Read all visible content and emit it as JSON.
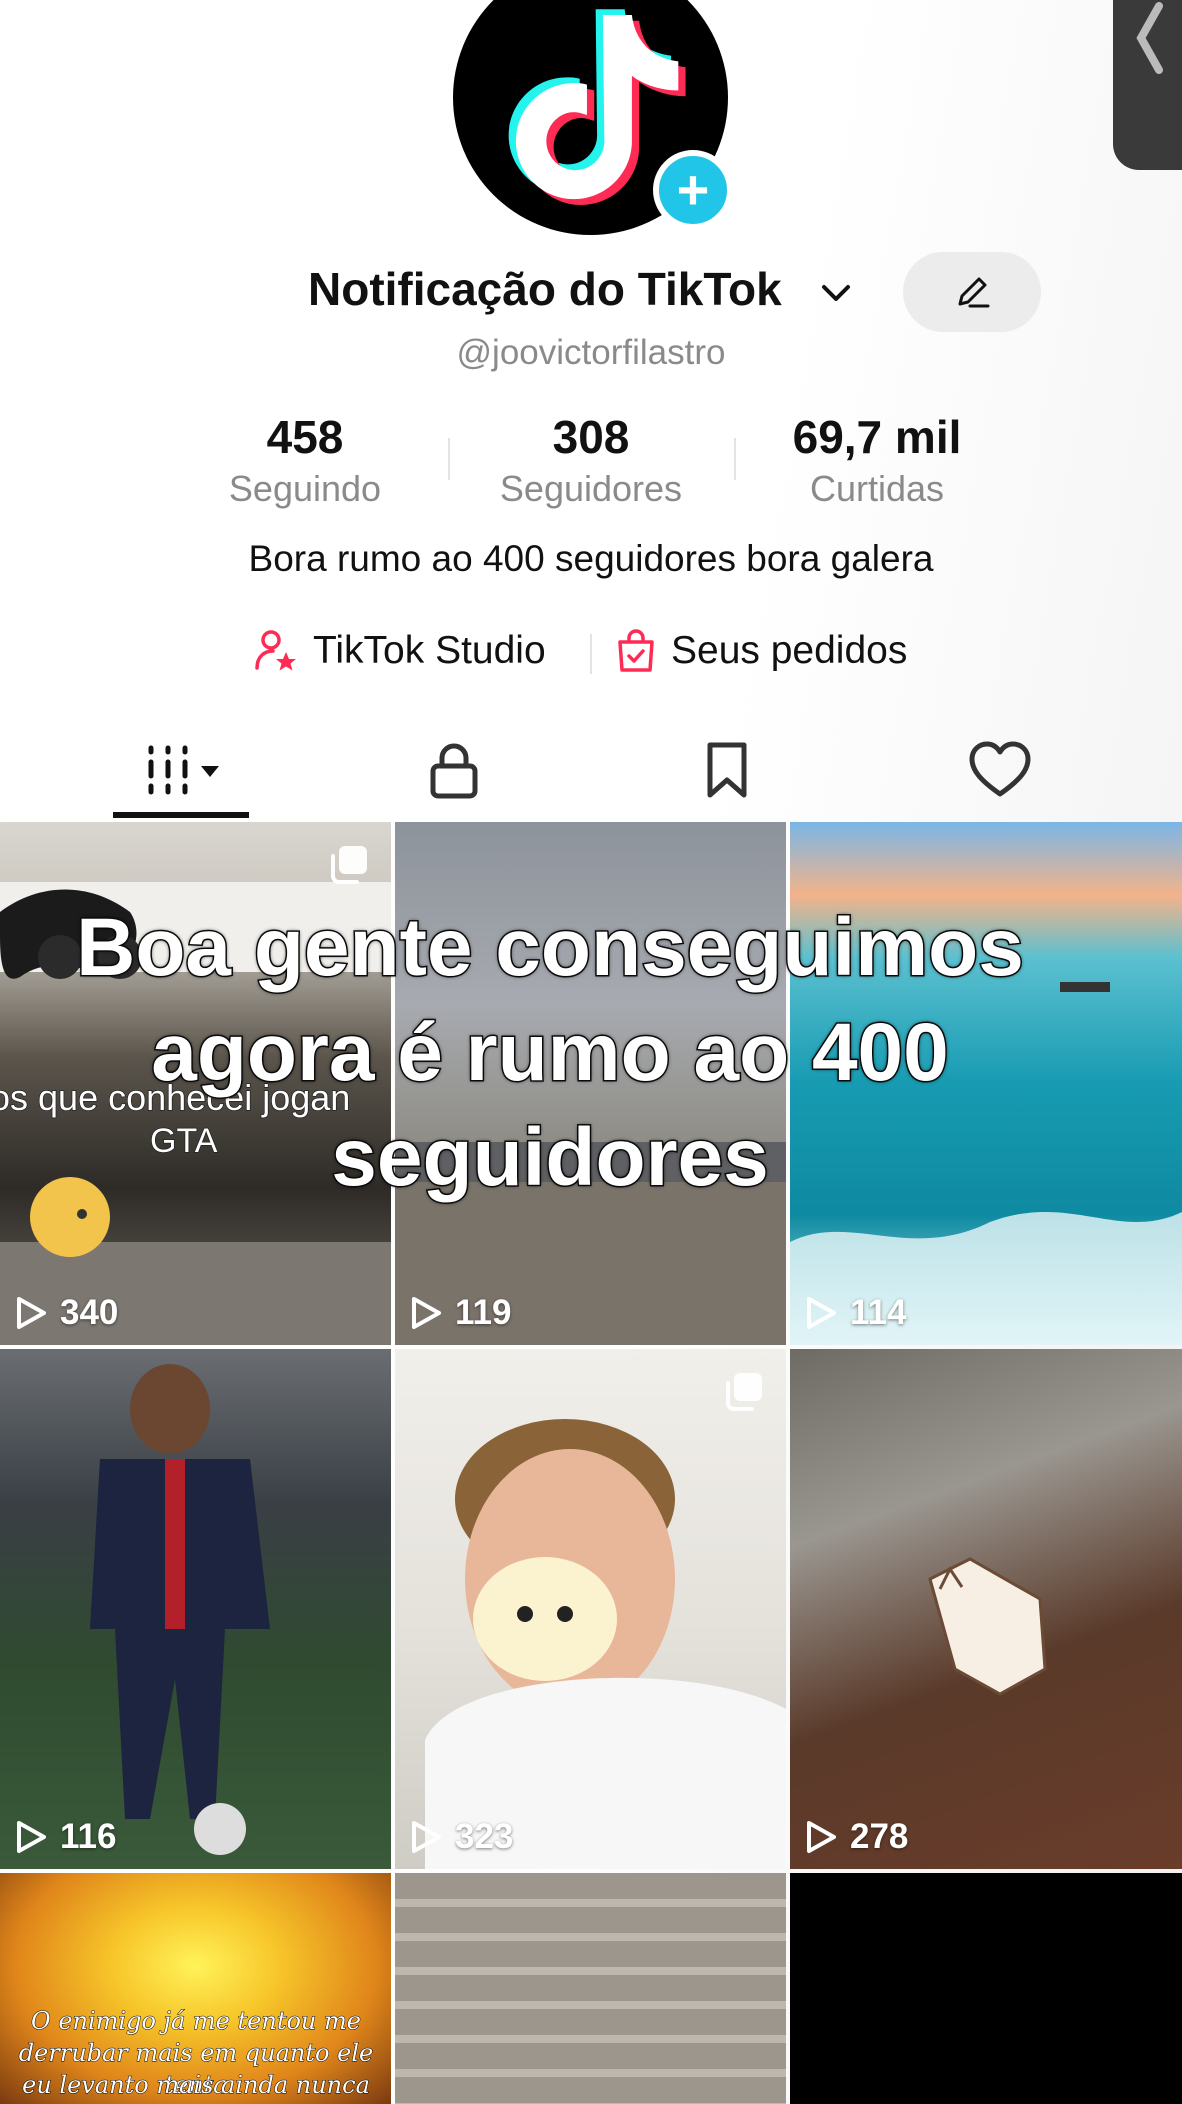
{
  "profile": {
    "name": "Notificação do TikTok",
    "handle": "@joovictorfilastro",
    "bio": "Bora rumo ao 400 seguidores bora galera"
  },
  "stats": [
    {
      "value": "458",
      "label": "Seguindo"
    },
    {
      "value": "308",
      "label": "Seguidores"
    },
    {
      "value": "69,7 mil",
      "label": "Curtidas"
    }
  ],
  "links": {
    "studio": "TikTok Studio",
    "orders": "Seus pedidos"
  },
  "tabs": [
    "videos-grid-icon",
    "lock-icon",
    "bookmark-icon",
    "heart-icon"
  ],
  "overlay_caption": [
    "Boa gente conseguimos",
    "agora é rumo ao 400",
    "seguidores"
  ],
  "videos": [
    {
      "views": "340",
      "text": [
        "os que conhecei jogan",
        "GTA"
      ]
    },
    {
      "views": "119"
    },
    {
      "views": "114"
    },
    {
      "views": "116"
    },
    {
      "views": "323"
    },
    {
      "views": "278"
    },
    {
      "text": [
        "O enimigo já me tentou me",
        "derrubar mais em quanto ele tenta",
        "eu levanto mais ainda nunca"
      ]
    },
    {},
    {}
  ],
  "colors": {
    "accent_pink": "#fe2c55",
    "tiktok_cyan": "#25f4ee",
    "add_button": "#20c5e8"
  }
}
